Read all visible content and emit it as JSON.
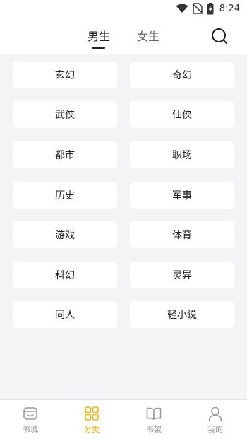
{
  "status_bar": {
    "time": "8:24"
  },
  "header": {
    "tabs": [
      {
        "label": "男生",
        "active": true
      },
      {
        "label": "女生",
        "active": false
      }
    ],
    "search_icon": "search-icon"
  },
  "categories": [
    {
      "label": "玄幻"
    },
    {
      "label": "奇幻"
    },
    {
      "label": "武侠"
    },
    {
      "label": "仙侠"
    },
    {
      "label": "都市"
    },
    {
      "label": "职场"
    },
    {
      "label": "历史"
    },
    {
      "label": "军事"
    },
    {
      "label": "游戏"
    },
    {
      "label": "体育"
    },
    {
      "label": "科幻"
    },
    {
      "label": "灵异"
    },
    {
      "label": "同人"
    },
    {
      "label": "轻小说"
    }
  ],
  "bottom_nav": {
    "items": [
      {
        "label": "书城",
        "icon": "bookstore-icon",
        "active": false
      },
      {
        "label": "分类",
        "icon": "category-grid-icon",
        "active": true
      },
      {
        "label": "书架",
        "icon": "bookshelf-icon",
        "active": false
      },
      {
        "label": "我的",
        "icon": "profile-icon",
        "active": false
      }
    ],
    "active_color": "#f2b600",
    "inactive_color": "#9a9a9a"
  }
}
